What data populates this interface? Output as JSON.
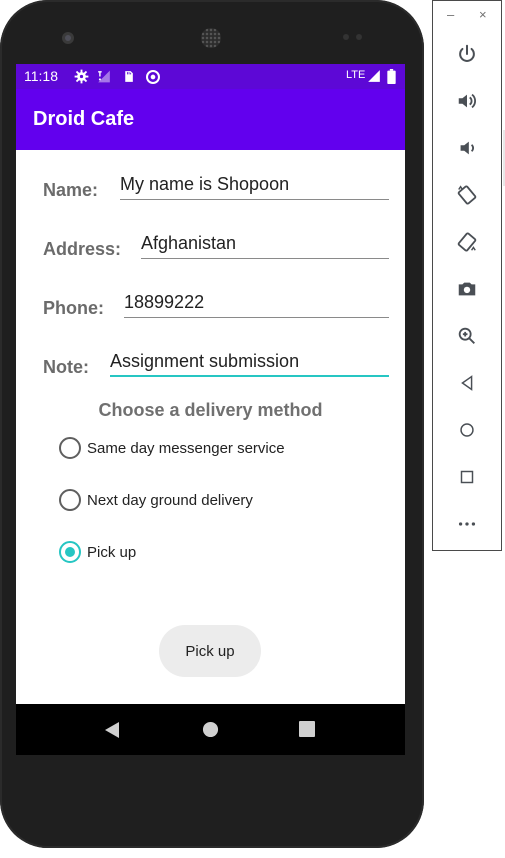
{
  "emulator": {
    "window_controls": {
      "minimize": "–",
      "close": "×"
    },
    "tools": [
      "power-icon",
      "volume-up-icon",
      "volume-down-icon",
      "rotate-left-icon",
      "rotate-right-icon",
      "camera-icon",
      "zoom-icon",
      "back-icon",
      "home-icon",
      "overview-icon",
      "more-icon"
    ]
  },
  "status_bar": {
    "time": "11:18",
    "network": "LTE"
  },
  "app_bar": {
    "title": "Droid Cafe"
  },
  "form": {
    "name": {
      "label": "Name:",
      "value": "My name is Shopoon"
    },
    "address": {
      "label": "Address:",
      "value": "Afghanistan"
    },
    "phone": {
      "label": "Phone:",
      "value": "18899222"
    },
    "note": {
      "label": "Note:",
      "value": "Assignment submission"
    }
  },
  "delivery": {
    "title": "Choose a delivery method",
    "options": [
      {
        "label": "Same day messenger service",
        "checked": false
      },
      {
        "label": "Next day ground delivery",
        "checked": false
      },
      {
        "label": "Pick up",
        "checked": true
      }
    ]
  },
  "button": {
    "label": "Pick up"
  },
  "colors": {
    "status_bar": "#5d08d6",
    "app_bar": "#6200ee",
    "accent": "#26c6c3"
  }
}
